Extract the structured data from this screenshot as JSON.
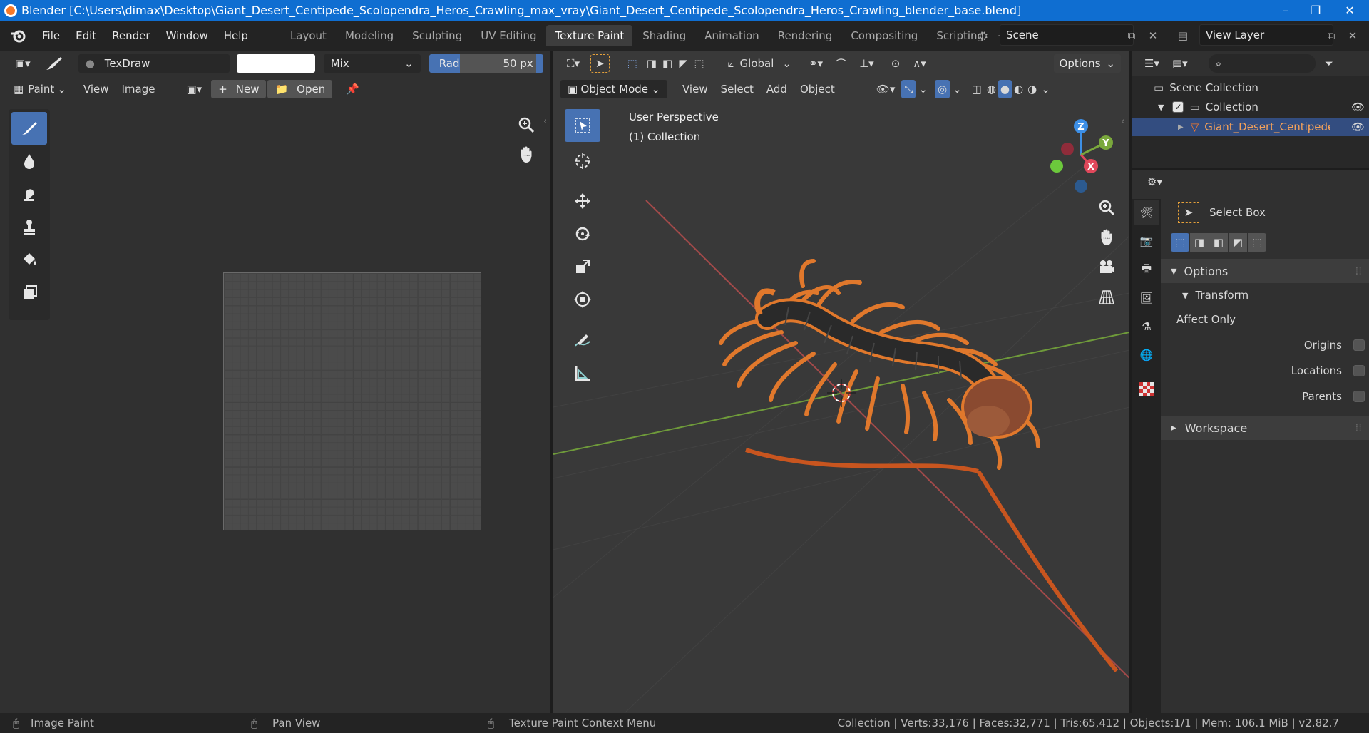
{
  "window": {
    "title": "Blender [C:\\Users\\dimax\\Desktop\\Giant_Desert_Centipede_Scolopendra_Heros_Crawling_max_vray\\Giant_Desert_Centipede_Scolopendra_Heros_Crawling_blender_base.blend]",
    "minimize": "–",
    "maximize": "❐",
    "close": "✕"
  },
  "menu": {
    "items": [
      "File",
      "Edit",
      "Render",
      "Window",
      "Help"
    ]
  },
  "workspaces": {
    "tabs": [
      "Layout",
      "Modeling",
      "Sculpting",
      "UV Editing",
      "Texture Paint",
      "Shading",
      "Animation",
      "Rendering",
      "Compositing",
      "Scripting"
    ],
    "active": "Texture Paint",
    "add": "+"
  },
  "scene": {
    "name": "Scene",
    "view_layer": "View Layer"
  },
  "image_editor": {
    "brush_name": "TexDraw",
    "blend_mode": "Mix",
    "radius_label": "Radius",
    "radius_value": "50 px",
    "mode": "Paint",
    "view": "View",
    "image": "Image",
    "new": "New",
    "open": "Open"
  },
  "viewport": {
    "orientation": "Global",
    "options": "Options",
    "mode": "Object Mode",
    "menus": [
      "View",
      "Select",
      "Add",
      "Object"
    ],
    "overlay_title": "User Perspective",
    "overlay_collection": "(1) Collection",
    "axes": {
      "z": "Z",
      "y": "Y",
      "x": "X"
    }
  },
  "outliner": {
    "scene_collection": "Scene Collection",
    "collection": "Collection",
    "object": "Giant_Desert_Centipede"
  },
  "properties": {
    "tool": "Select Box",
    "options": "Options",
    "transform": "Transform",
    "affect_only": "Affect Only",
    "origins": "Origins",
    "locations": "Locations",
    "parents": "Parents",
    "workspace": "Workspace"
  },
  "status": {
    "left": "Image Paint",
    "middle": "Pan View",
    "right": "Texture Paint Context Menu",
    "stats": "Collection | Verts:33,176 | Faces:32,771 | Tris:65,412 | Objects:1/1 | Mem: 106.1 MiB | v2.82.7"
  },
  "colors": {
    "accent": "#4772b3",
    "selected_object": "#f5792a",
    "titlebar": "#0f6ed1"
  }
}
